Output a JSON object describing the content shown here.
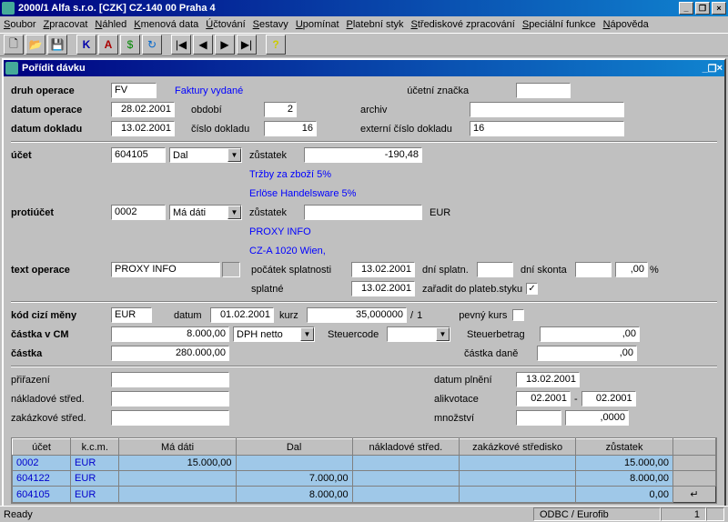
{
  "title": "2000/1  Alfa s.r.o. [CZK] CZ-140 00  Praha 4",
  "menu": [
    "Soubor",
    "Zpracovat",
    "Náhled",
    "Kmenová data",
    "Účtování",
    "Sestavy",
    "Upomínat",
    "Platební styk",
    "Střediskové zpracování",
    "Speciální funkce",
    "Nápověda"
  ],
  "subwin_title": "Pořídit dávku",
  "labels": {
    "druh_operace": "druh operace",
    "datum_operace": "datum operace",
    "datum_dokladu": "datum dokladu",
    "obdobi": "období",
    "cislo_dokladu": "číslo dokladu",
    "ucetni_znacka": "účetní značka",
    "archiv": "archiv",
    "externi_cislo": "externí číslo dokladu",
    "ucet": "účet",
    "zustatek": "zůstatek",
    "protiucet": "protiúčet",
    "text_operace": "text operace",
    "pocatek_spl": "počátek splatnosti",
    "dni_splatn": "dní splatn.",
    "dni_skonta": "dní skonta",
    "splatne": "splatné",
    "zaradit": "zařadit do plateb.styku",
    "kod_meny": "kód cizí měny",
    "datum": "datum",
    "kurz": "kurz",
    "pevny_kurs": "pevný kurs",
    "castka_cm": "částka v CM",
    "steuercode": "Steuercode",
    "steuerbetrag": "Steuerbetrag",
    "castka": "částka",
    "castka_dane": "částka daně",
    "prirazeni": "přiřazení",
    "nakladove": "nákladové střed.",
    "zakazkove": "zakázkové střed.",
    "datum_plneni": "datum plnění",
    "alikvotace": "alikvotace",
    "mnozstvi": "množství"
  },
  "values": {
    "druh_op": "FV",
    "druh_op_text": "Faktury vydané",
    "datum_operace": "28.02.2001",
    "obdobi": "2",
    "datum_dokladu": "13.02.2001",
    "cislo_dokladu": "16",
    "externi_cislo": "16",
    "ucet": "604105",
    "ucet_side": "Dal",
    "ucet_zustatek": "-190,48",
    "ucet_desc1": "Tržby za zboží 5%",
    "ucet_desc2": "Erlöse Handelsware 5%",
    "protiucet": "0002",
    "protiucet_side": "Má dáti",
    "protiucet_zustatek": "",
    "protiucet_cur": "EUR",
    "protiucet_desc1": "PROXY INFO",
    "protiucet_desc2": "CZ-A 1020 Wien,",
    "text_operace": "PROXY INFO",
    "poc_spl": "13.02.2001",
    "splatne": "13.02.2001",
    "dni_skonta": ",00",
    "percent": "%",
    "zaradit_chk": "✓",
    "mena": "EUR",
    "mena_datum": "01.02.2001",
    "kurz": "35,000000",
    "kurz_div": "/",
    "kurz_divnum": "1",
    "castka_cm": "8.000,00",
    "dph": "DPH netto",
    "steuerbetrag": ",00",
    "castka": "280.000,00",
    "castka_dane": ",00",
    "datum_plneni": "13.02.2001",
    "alik_from": "02.2001",
    "alik_dash": "-",
    "alik_to": "02.2001",
    "mnozstvi": ",0000"
  },
  "grid": {
    "headers": [
      "účet",
      "k.c.m.",
      "Má dáti",
      "Dal",
      "nákladové střed.",
      "zakázkové středisko",
      "zůstatek"
    ],
    "rows": [
      {
        "ucet": "0002",
        "kcm": "EUR",
        "md": "15.000,00",
        "dal": "",
        "nakl": "",
        "zak": "",
        "zust": "15.000,00"
      },
      {
        "ucet": "604122",
        "kcm": "EUR",
        "md": "",
        "dal": "7.000,00",
        "nakl": "",
        "zak": "",
        "zust": "8.000,00"
      },
      {
        "ucet": "604105",
        "kcm": "EUR",
        "md": "",
        "dal": "8.000,00",
        "nakl": "",
        "zak": "",
        "zust": "0,00"
      }
    ]
  },
  "status": {
    "ready": "Ready",
    "db": "ODBC / Eurofib",
    "page": "1"
  }
}
